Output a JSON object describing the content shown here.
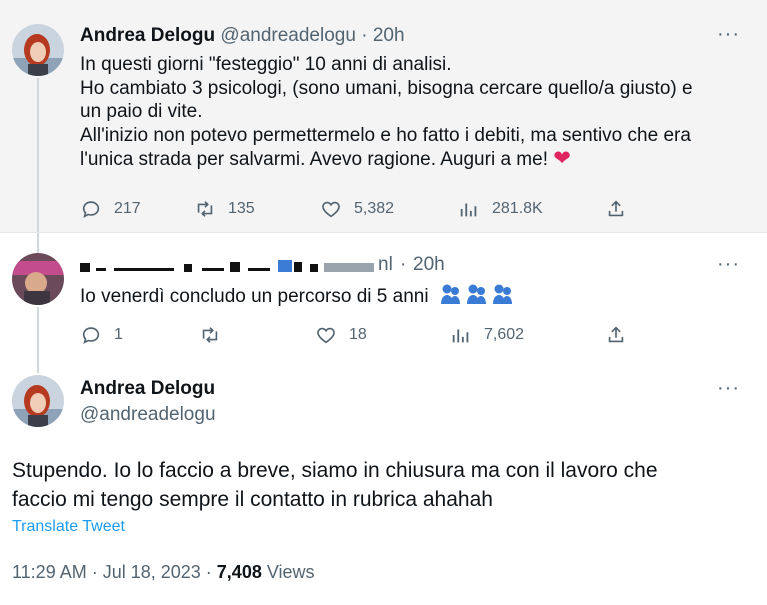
{
  "tweet1": {
    "name": "Andrea Delogu",
    "handle": "@andreadelogu",
    "separator": "·",
    "time": "20h",
    "more": "···",
    "lines": [
      "In questi giorni \"festeggio\" 10 anni di analisi.",
      "Ho cambiato 3 psicologi, (sono umani, bisogna cercare quello/a giusto) e",
      "un paio di vite.",
      "All'inizio non potevo permettermelo e ho fatto i debiti, ma sentivo che era",
      "l'unica strada per salvarmi. Avevo ragione. Auguri a me!"
    ],
    "emoji": "❤",
    "replies": "217",
    "retweets": "135",
    "likes": "5,382",
    "views": "281.8K"
  },
  "tweet2": {
    "handle_partial": "nl",
    "separator": "·",
    "time": "20h",
    "more": "···",
    "text": "Io venerdì concludo un percorso di 5 anni",
    "replies": "1",
    "retweets": "",
    "likes": "18",
    "views": "7,602"
  },
  "tweet3": {
    "name": "Andrea Delogu",
    "handle": "@andreadelogu",
    "more": "···",
    "lines": [
      "Stupendo. Io lo faccio a breve, siamo in chiusura ma con il lavoro che",
      "faccio mi tengo sempre il contatto in rubrica ahahah"
    ],
    "translate": "Translate Tweet",
    "timestamp": "11:29 AM · Jul 18, 2023 · ",
    "views_count": "7,408",
    "views_label": " Views"
  },
  "colors": {
    "accent": "#1d9bf0",
    "muted": "#536471",
    "heart": "#e0245e"
  }
}
